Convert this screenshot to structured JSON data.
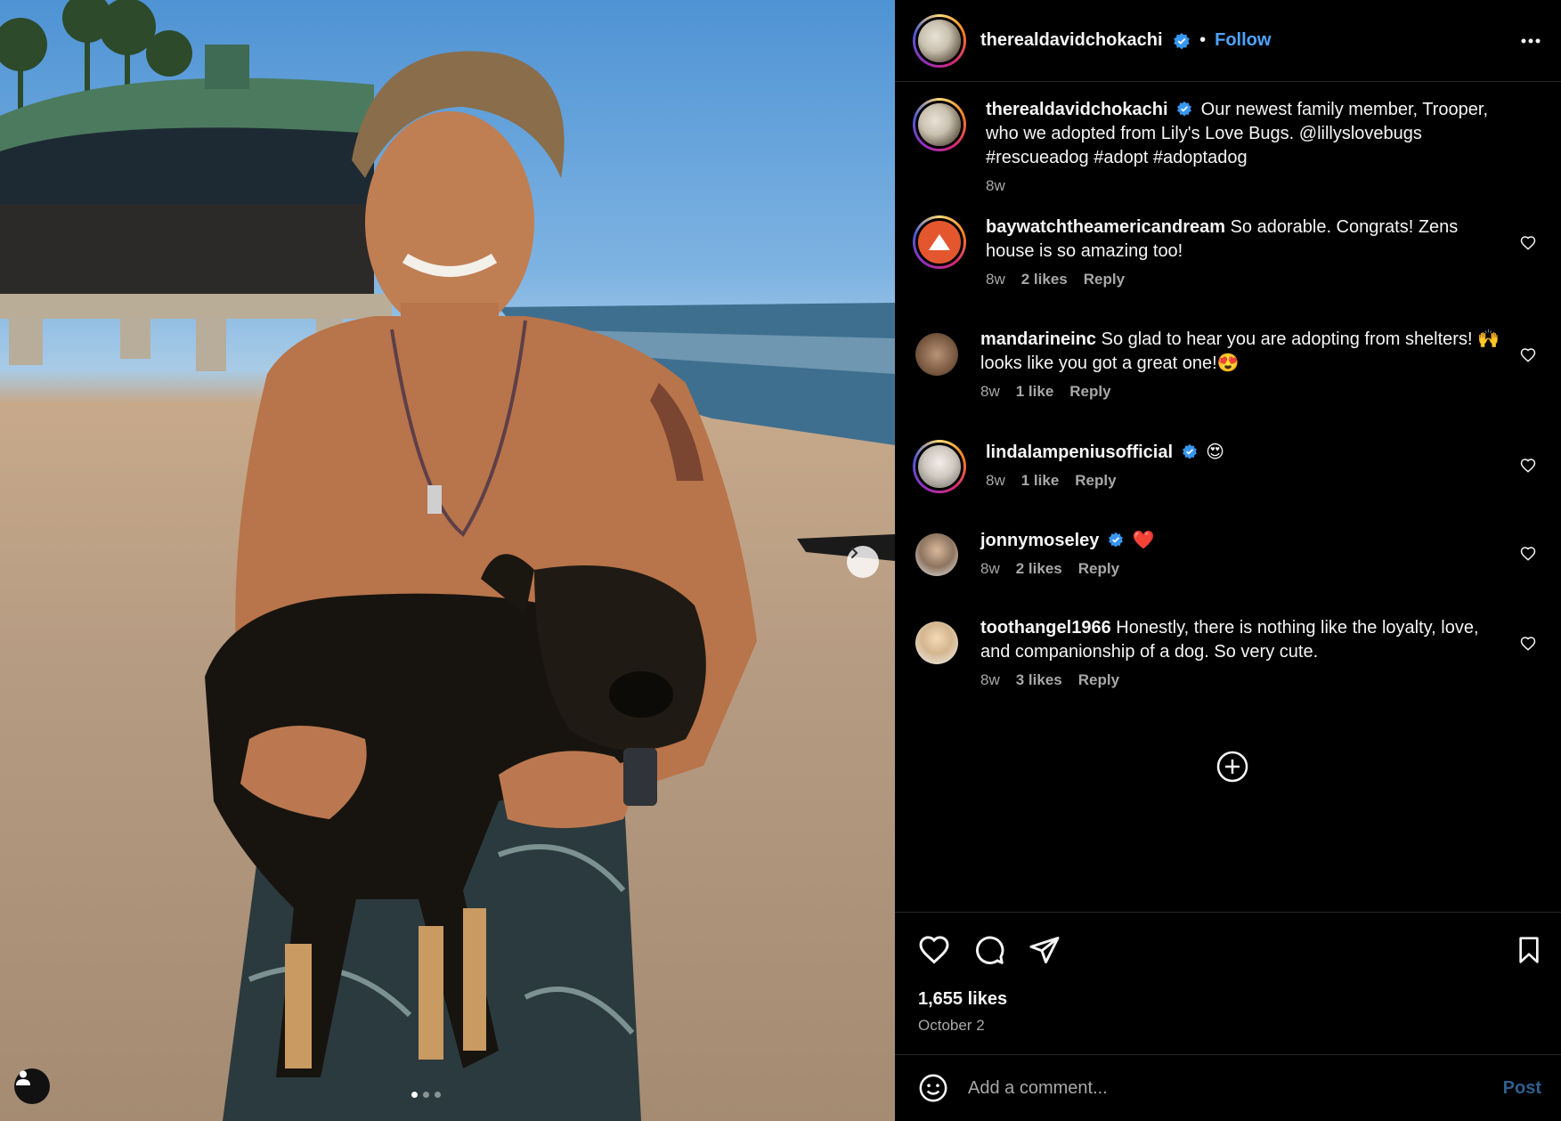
{
  "post": {
    "owner": "therealdavidchokachi",
    "follow_label": "Follow",
    "separator": "•",
    "caption": "Our newest family member, Trooper, who we adopted from Lily's Love Bugs. @lillyslovebugs #rescueadog #adopt #adoptadog",
    "caption_time": "8w",
    "likes": "1,655 likes",
    "date": "October 2"
  },
  "comments": [
    {
      "user": "baywatchtheamericandream",
      "verified": false,
      "text": "So adorable. Congrats! Zens house is so amazing too!",
      "time": "8w",
      "likes": "2 likes",
      "reply": "Reply"
    },
    {
      "user": "mandarineinc",
      "verified": false,
      "text": "So glad to hear you are adopting from shelters! 🙌 looks like you got a great one!😍",
      "time": "8w",
      "likes": "1 like",
      "reply": "Reply"
    },
    {
      "user": "lindalampeniusofficial",
      "verified": true,
      "text": "😍",
      "time": "8w",
      "likes": "1 like",
      "reply": "Reply"
    },
    {
      "user": "jonnymoseley",
      "verified": true,
      "text": "❤️",
      "time": "8w",
      "likes": "2 likes",
      "reply": "Reply"
    },
    {
      "user": "toothangel1966",
      "verified": false,
      "text": "Honestly, there is nothing like the loyalty, love, and companionship of a dog. So very cute.",
      "time": "8w",
      "likes": "3 likes",
      "reply": "Reply"
    }
  ],
  "add_comment": {
    "placeholder": "Add a comment...",
    "post_label": "Post"
  },
  "icons": [
    "verified-badge-icon",
    "more-options-icon",
    "heart-icon",
    "comment-icon",
    "share-icon",
    "bookmark-icon",
    "emoji-icon",
    "load-more-icon",
    "next-arrow-icon",
    "user-tag-icon"
  ],
  "colors": {
    "follow": "#4ea3ff",
    "verified": "#3897f0",
    "muted": "#a8a8a8",
    "post_disabled": "#2f5f8f"
  }
}
